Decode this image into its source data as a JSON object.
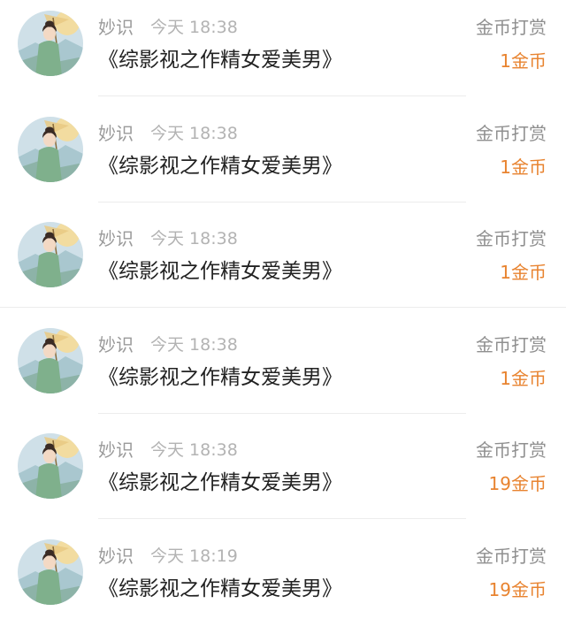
{
  "tips": [
    {
      "user": "妙识",
      "time": "今天 18:38",
      "book": "《综影视之作精女爱美男》",
      "label": "金币打赏",
      "amount": "1金币"
    },
    {
      "user": "妙识",
      "time": "今天 18:38",
      "book": "《综影视之作精女爱美男》",
      "label": "金币打赏",
      "amount": "1金币"
    },
    {
      "user": "妙识",
      "time": "今天 18:38",
      "book": "《综影视之作精女爱美男》",
      "label": "金币打赏",
      "amount": "1金币"
    },
    {
      "user": "妙识",
      "time": "今天 18:38",
      "book": "《综影视之作精女爱美男》",
      "label": "金币打赏",
      "amount": "1金币"
    },
    {
      "user": "妙识",
      "time": "今天 18:38",
      "book": "《综影视之作精女爱美男》",
      "label": "金币打赏",
      "amount": "19金币"
    },
    {
      "user": "妙识",
      "time": "今天 18:19",
      "book": "《综影视之作精女爱美男》",
      "label": "金币打赏",
      "amount": "19金币"
    }
  ],
  "colors": {
    "amount": "#e8832f",
    "name": "#9a9a9a",
    "time": "#b3b3b3",
    "title": "#222222",
    "divider": "#ececec"
  },
  "icons": {
    "avatar": "avatar-illustration-lady-with-parasol"
  }
}
